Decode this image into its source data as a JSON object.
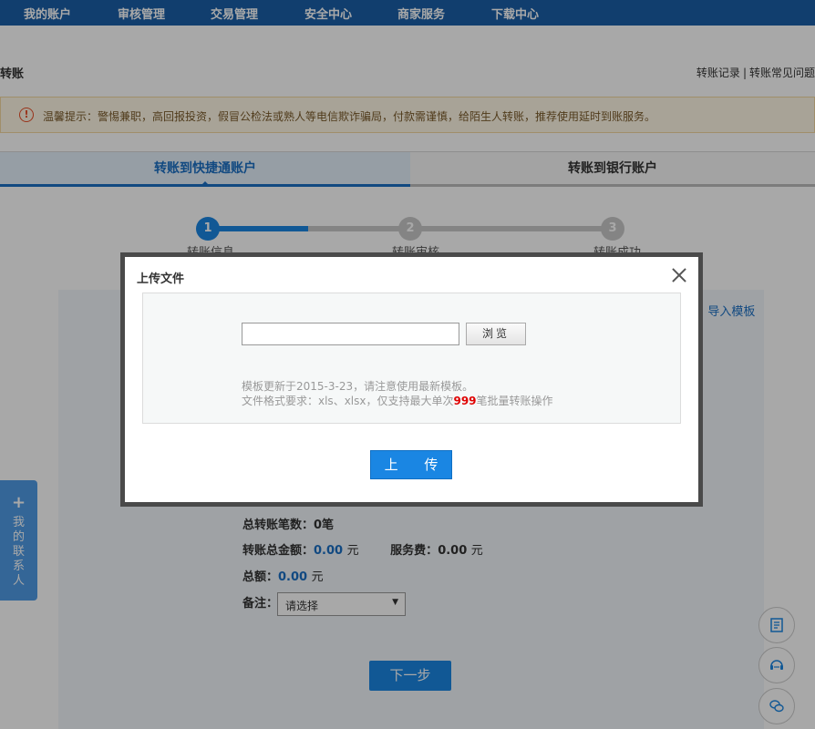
{
  "topnav": {
    "items": [
      "我的账户",
      "审核管理",
      "交易管理",
      "安全中心",
      "商家服务",
      "下载中心"
    ]
  },
  "page": {
    "title": "转账",
    "links": [
      "转账记录",
      "转账常见问题"
    ],
    "separator": "|"
  },
  "notice": {
    "icon": "warning-icon",
    "text": "温馨提示：警惕兼职，高回报投资，假冒公检法或熟人等电信欺诈骗局，付款需谨慎，给陌生人转账，推荐使用延时到账服务。"
  },
  "tabs": [
    {
      "label": "转账到快捷通账户",
      "active": true
    },
    {
      "label": "转账到银行账户",
      "active": false
    }
  ],
  "steps": [
    {
      "num": "1",
      "label": "转账信息",
      "active": true
    },
    {
      "num": "2",
      "label": "转账审核",
      "active": false
    },
    {
      "num": "3",
      "label": "转账成功",
      "active": false
    }
  ],
  "form": {
    "import_link": "导入模板",
    "total_count_label": "总转账笔数：",
    "total_count_value": "0笔",
    "total_amount_label": "转账总金额：",
    "total_amount_value": "0.00",
    "unit": "元",
    "fee_label": "服务费：",
    "fee_value": "0.00",
    "sum_label": "总额：",
    "sum_value": "0.00",
    "remark_label": "备注：",
    "remark_select": "请选择",
    "next_button": "下一步"
  },
  "contacts_tab": {
    "plus": "+",
    "label": "我的联系人"
  },
  "float_buttons": [
    "document-icon",
    "customer-service-icon",
    "chat-icon"
  ],
  "modal": {
    "title": "上传文件",
    "file_value": "",
    "browse_label": "浏览",
    "hint_line1": "模板更新于2015-3-23，请注意使用最新模板。",
    "hint_line2_prefix": "文件格式要求：xls、xlsx，仅支持最大单次",
    "hint_line2_number": "999",
    "hint_line2_suffix": "笔批量转账操作",
    "upload_button": "上 传"
  },
  "colors": {
    "nav_bg": "#1a5fa8",
    "accent": "#1a86e3",
    "link": "#1a6fc4",
    "warning": "#e8502a",
    "highlight_red": "#e00000"
  }
}
